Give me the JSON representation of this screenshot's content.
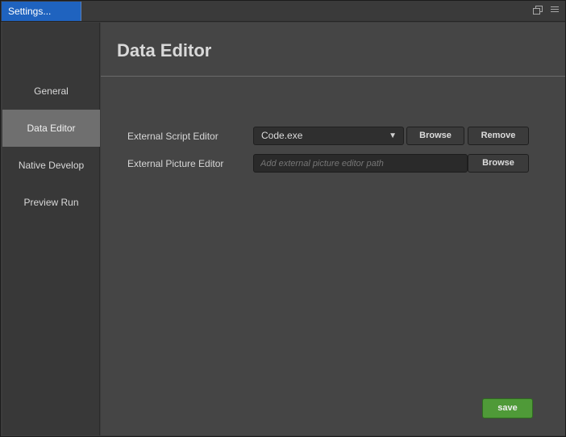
{
  "window": {
    "tab_title": "Settings...",
    "icons": [
      "restore-icon",
      "menu-icon"
    ]
  },
  "sidebar": {
    "items": [
      {
        "label": "General",
        "active": false
      },
      {
        "label": "Data Editor",
        "active": true
      },
      {
        "label": "Native Develop",
        "active": false
      },
      {
        "label": "Preview Run",
        "active": false
      }
    ]
  },
  "main": {
    "title": "Data Editor",
    "script_editor": {
      "label": "External Script Editor",
      "selected": "Code.exe",
      "browse_label": "Browse",
      "remove_label": "Remove"
    },
    "picture_editor": {
      "label": "External Picture Editor",
      "value": "",
      "placeholder": "Add external picture editor path",
      "browse_label": "Browse"
    },
    "save_label": "save"
  },
  "colors": {
    "tab_accent": "#1f63bf",
    "active_nav": "#6f6f6f",
    "save_button": "#4f9a38",
    "panel_bg": "#454545"
  }
}
